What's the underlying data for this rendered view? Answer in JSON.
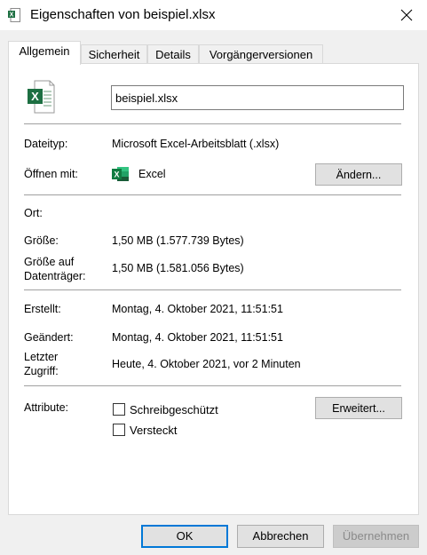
{
  "window": {
    "title": "Eigenschaften von beispiel.xlsx",
    "accent_excel": "#1d6f42"
  },
  "tabs": [
    {
      "label": "Allgemein",
      "active": true
    },
    {
      "label": "Sicherheit",
      "active": false
    },
    {
      "label": "Details",
      "active": false
    },
    {
      "label": "Vorgängerversionen",
      "active": false
    }
  ],
  "general": {
    "filename": "beispiel.xlsx",
    "filetype_label": "Dateityp:",
    "filetype_value": "Microsoft Excel-Arbeitsblatt (.xlsx)",
    "openwith_label": "Öffnen mit:",
    "openwith_value": "Excel",
    "change_button": "Ändern...",
    "location_label": "Ort:",
    "location_value": "",
    "size_label": "Größe:",
    "size_value": "1,50 MB (1.577.739 Bytes)",
    "disksize_label_1": "Größe auf",
    "disksize_label_2": "Datenträger:",
    "disksize_value": "1,50 MB (1.581.056 Bytes)",
    "created_label": "Erstellt:",
    "created_value": "Montag, 4. Oktober 2021, 11:51:51",
    "modified_label": "Geändert:",
    "modified_value": "Montag, 4. Oktober 2021, 11:51:51",
    "accessed_label_1": "Letzter",
    "accessed_label_2": "Zugriff:",
    "accessed_value": "Heute, 4. Oktober 2021, vor 2 Minuten",
    "attributes_label": "Attribute:",
    "readonly_label": "Schreibgeschützt",
    "readonly_checked": false,
    "hidden_label": "Versteckt",
    "hidden_checked": false,
    "advanced_button": "Erweitert..."
  },
  "footer": {
    "ok": "OK",
    "cancel": "Abbrechen",
    "apply": "Übernehmen"
  }
}
